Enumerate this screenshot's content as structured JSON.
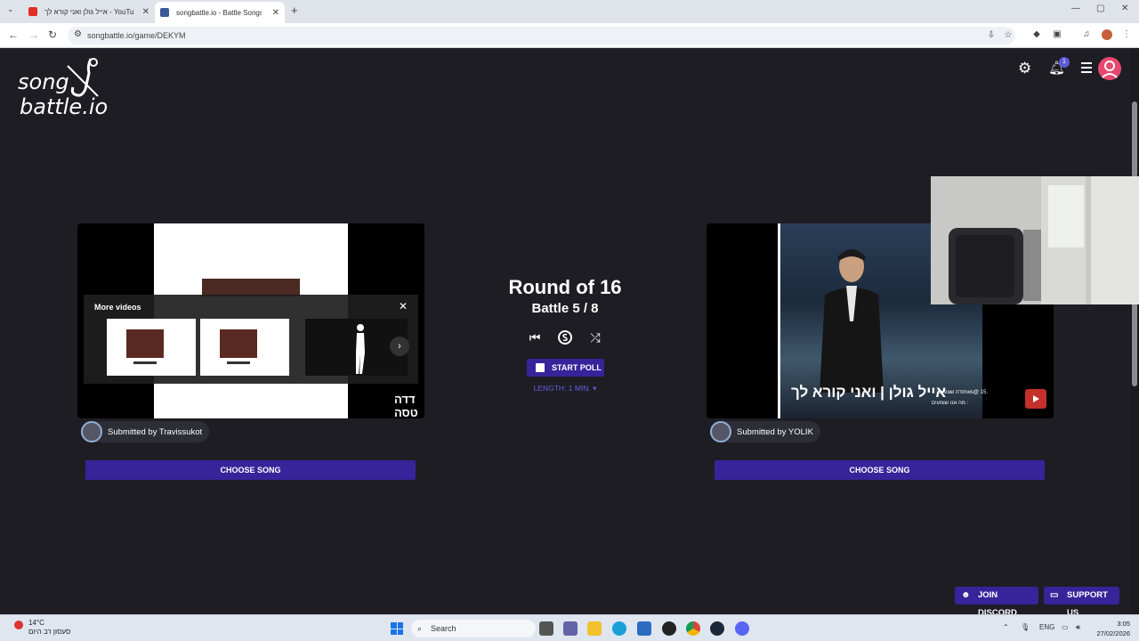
{
  "browser": {
    "tabs": [
      {
        "title": "אייל גולן ואני קורא לך - YouTube",
        "icon": "youtube-icon",
        "color": "#e52d27"
      },
      {
        "title": "songbattle.io - Battle Songs",
        "icon": "songbattle-icon",
        "color": "#3b5998"
      }
    ],
    "new_tab": "+",
    "url": "songbattle.io/game/DEKYM"
  },
  "site": {
    "logo_line1": "song",
    "logo_line2": "battle.io",
    "notification_count": "1"
  },
  "left_player": {
    "more_videos_label": "More videos",
    "watermark": "דדה טסה",
    "submitted_by": "Submitted by Travissukot",
    "choose_label": "CHOOSE SONG"
  },
  "right_player": {
    "video_title": "אייל גולן | ואני קורא לך",
    "overlay_line1": "תודה שצפית : 1ws@ 15.",
    "overlay_line2": "מה אנו שומעים :",
    "submitted_by": "Submitted by YOLIK",
    "choose_label": "CHOOSE SONG"
  },
  "battle": {
    "round": "Round of 16",
    "battle_label": "Battle 5 / 8",
    "start_poll": "START POLL",
    "length": "LENGTH: 1 MIN. ▾"
  },
  "footer": {
    "join_discord": "JOIN DISCORD",
    "support_us": "SUPPORT US"
  },
  "taskbar": {
    "temp": "14°C",
    "weather": "סעסון רב היום",
    "search": "Search",
    "lang": "ENG",
    "time": "3:05",
    "date": "27/02/2026"
  },
  "colors": {
    "accent": "#38249a",
    "background": "#1e1d24",
    "avatar": "#e84870"
  }
}
